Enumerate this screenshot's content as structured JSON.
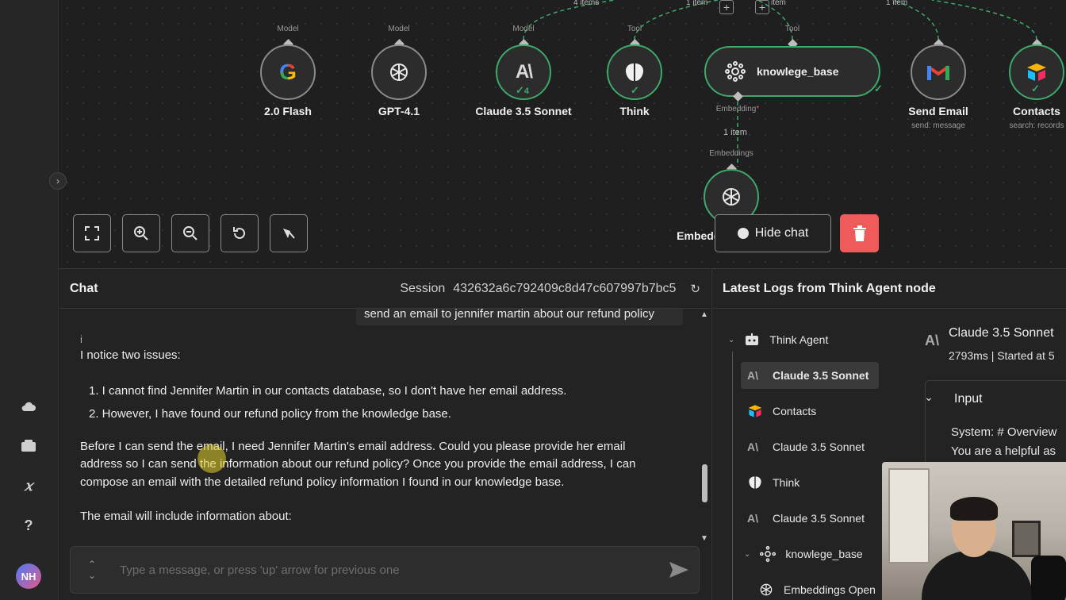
{
  "canvas": {
    "nodes": [
      {
        "port": "Model",
        "label": "2.0 Flash",
        "icon": "google-gemini-icon"
      },
      {
        "port": "Model",
        "label": "GPT-4.1",
        "icon": "openai-icon"
      },
      {
        "port": "Model",
        "label": "Claude 3.5 Sonnet",
        "icon": "anthropic-icon",
        "badge": "4"
      },
      {
        "port": "Tool",
        "label": "Think",
        "icon": "brain-icon"
      },
      {
        "port": "Tool",
        "label": "knowlege_base",
        "icon": "vector-store-icon"
      },
      {
        "port": "",
        "label": "Send Email",
        "sub": "send: message",
        "icon": "gmail-icon"
      },
      {
        "port": "",
        "label": "Contacts",
        "sub": "search: records",
        "icon": "airtable-icon"
      }
    ],
    "embedding_port": "Embedding",
    "embedding_items": "1 item",
    "embeddings_port": "Embeddings",
    "embeddings_node_label": "Embeddings OpenAI",
    "wire_labels": {
      "a": "4 items",
      "b": "1 item",
      "c": "item",
      "d": "1 item"
    },
    "hide_chat_label": "Hide chat"
  },
  "chat": {
    "title": "Chat",
    "session_label": "Session",
    "session_id": "432632a6c792409c8d47c607997b7bc5",
    "user_message": "send an email to jennifer martin about our refund policy",
    "info_glyph": "i",
    "bot_intro": "I notice two issues:",
    "bot_list": [
      "1. I cannot find Jennifer Martin in our contacts database, so I don't have her email address.",
      "2. However, I have found our refund policy from the knowledge base."
    ],
    "bot_para_lines": [
      "Before I can send the email, I need Jennifer Martin's email address. Could you please provide her email",
      "address so I can send the information about our refund policy? Once you provide the email address, I can",
      "compose an email with the detailed refund policy information I found in our knowledge base."
    ],
    "bot_outro": "The email will include information about:",
    "input_placeholder": "Type a message, or press 'up' arrow for previous one"
  },
  "logs": {
    "title": "Latest Logs from Think Agent node",
    "tree": [
      {
        "label": "Think Agent",
        "icon": "robot-icon"
      },
      {
        "label": "Claude 3.5 Sonnet",
        "icon": "anthropic-icon",
        "active": true
      },
      {
        "label": "Contacts",
        "icon": "airtable-icon"
      },
      {
        "label": "Claude 3.5 Sonnet",
        "icon": "anthropic-icon"
      },
      {
        "label": "Think",
        "icon": "brain-icon"
      },
      {
        "label": "Claude 3.5 Sonnet",
        "icon": "anthropic-icon"
      },
      {
        "label": "knowlege_base",
        "icon": "vector-store-icon"
      },
      {
        "label": "Embeddings Open",
        "icon": "openai-icon"
      }
    ],
    "detail_title": "Claude 3.5 Sonnet",
    "detail_sub": "2793ms | Started at 5",
    "input_heading": "Input",
    "input_lines": [
      "System: # Overview",
      "You are a helpful as"
    ]
  },
  "sidebar": {
    "avatar_initials": "NH",
    "icons": [
      "cloud-icon",
      "templates-icon",
      "variables-icon",
      "help-icon"
    ]
  },
  "colors": {
    "success": "#3ea86a",
    "danger": "#ef5a5a",
    "panel": "#232323"
  }
}
